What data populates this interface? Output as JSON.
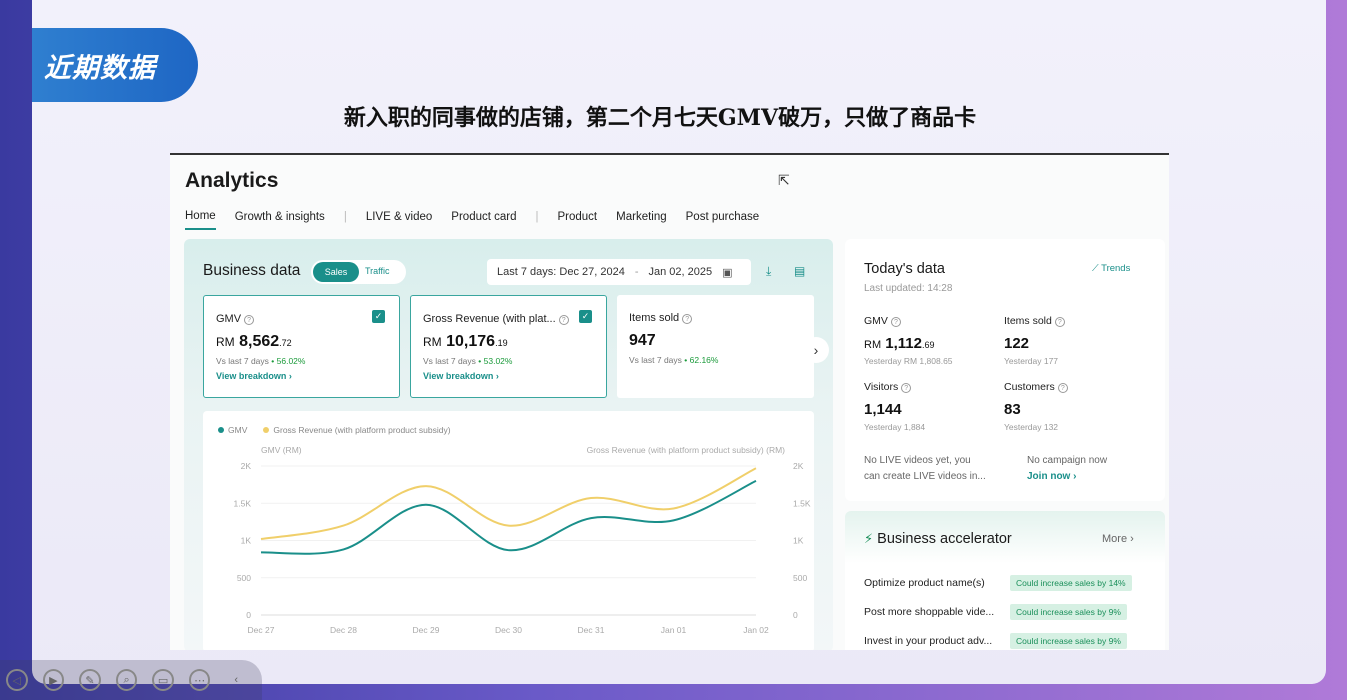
{
  "slide": {
    "badge": "近期数据",
    "headline": "新入职的同事做的店铺，第二个月七天GMV破万，只做了商品卡"
  },
  "analytics": {
    "title": "Analytics",
    "tabs": [
      "Home",
      "Growth & insights",
      "LIVE & video",
      "Product card",
      "Product",
      "Marketing",
      "Post purchase"
    ],
    "business": {
      "title": "Business data",
      "toggle_sales": "Sales",
      "toggle_traffic": "Traffic",
      "date_label": "Last 7 days:",
      "date_start": "Dec 27, 2024",
      "date_sep": "-",
      "date_end": "Jan 02, 2025",
      "cards": [
        {
          "label": "GMV",
          "currency": "RM",
          "value": "8,562",
          "decimal": ".72",
          "vs": "Vs last 7 days",
          "change": "56.02%",
          "link": "View breakdown"
        },
        {
          "label": "Gross Revenue (with plat...",
          "currency": "RM",
          "value": "10,176",
          "decimal": ".19",
          "vs": "Vs last 7 days",
          "change": "53.02%",
          "link": "View breakdown"
        },
        {
          "label": "Items sold",
          "currency": "",
          "value": "947",
          "decimal": "",
          "vs": "Vs last 7 days",
          "change": "62.16%",
          "link": ""
        }
      ]
    },
    "today": {
      "title": "Today's data",
      "updated": "Last updated: 14:28",
      "trends": "Trends",
      "metrics": [
        {
          "label": "GMV",
          "currency": "RM",
          "value": "1,112",
          "decimal": ".69",
          "yesterday": "Yesterday RM 1,808.65"
        },
        {
          "label": "Items sold",
          "currency": "",
          "value": "122",
          "decimal": "",
          "yesterday": "Yesterday 177"
        },
        {
          "label": "Visitors",
          "currency": "",
          "value": "1,144",
          "decimal": "",
          "yesterday": "Yesterday 1,884"
        },
        {
          "label": "Customers",
          "currency": "",
          "value": "83",
          "decimal": "",
          "yesterday": "Yesterday 132"
        }
      ],
      "live_note_1": "No LIVE videos yet, you",
      "live_note_2": "can create LIVE videos in...",
      "campaign_note": "No campaign now",
      "join": "Join now"
    },
    "accelerator": {
      "title": "Business accelerator",
      "more": "More",
      "tips": [
        {
          "text": "Optimize product name(s)",
          "badge": "Could increase sales by 14%"
        },
        {
          "text": "Post more shoppable vide...",
          "badge": "Could increase sales by 9%"
        },
        {
          "text": "Invest in your product adv...",
          "badge": "Could increase sales by 9%"
        }
      ]
    }
  },
  "chart_data": {
    "type": "line",
    "categories": [
      "Dec 27",
      "Dec 28",
      "Dec 29",
      "Dec 30",
      "Dec 31",
      "Jan 01",
      "Jan 02"
    ],
    "series": [
      {
        "name": "GMV",
        "color": "#1a8f8a",
        "values": [
          840,
          880,
          1480,
          870,
          1300,
          1270,
          1800
        ]
      },
      {
        "name": "Gross Revenue (with platform product subsidy)",
        "color": "#f0cf6a",
        "values": [
          1020,
          1200,
          1730,
          1200,
          1570,
          1430,
          1970
        ]
      }
    ],
    "ylabel_left": "GMV (RM)",
    "ylabel_right": "Gross Revenue (with platform product subsidy) (RM)",
    "yticks": [
      "0",
      "500",
      "1K",
      "1.5K",
      "2K"
    ],
    "ylim": [
      0,
      2000
    ]
  }
}
